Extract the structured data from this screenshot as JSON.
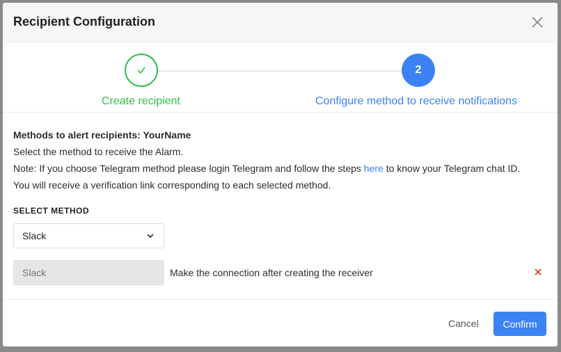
{
  "modal": {
    "title": "Recipient Configuration"
  },
  "stepper": {
    "steps": [
      {
        "label": "Create recipient",
        "status": "done"
      },
      {
        "label": "Configure method to receive notifications",
        "number": "2",
        "status": "active"
      }
    ]
  },
  "content": {
    "heading": "Methods to alert recipients: YourName",
    "line1": "Select the method to receive the Alarm.",
    "note_prefix": "Note: If you choose Telegram method please login Telegram and follow the steps ",
    "note_link": "here",
    "note_suffix": " to know your Telegram chat ID.",
    "line3": "You will receive a verification link corresponding to each selected method."
  },
  "method_select": {
    "label": "SELECT METHOD",
    "selected": "Slack"
  },
  "method_item": {
    "placeholder": "Slack",
    "note": "Make the connection after creating the receiver"
  },
  "footer": {
    "cancel_label": "Cancel",
    "confirm_label": "Confirm"
  },
  "colors": {
    "primary": "#3d82f5",
    "success": "#2fbf4a",
    "danger": "#e0401b"
  }
}
